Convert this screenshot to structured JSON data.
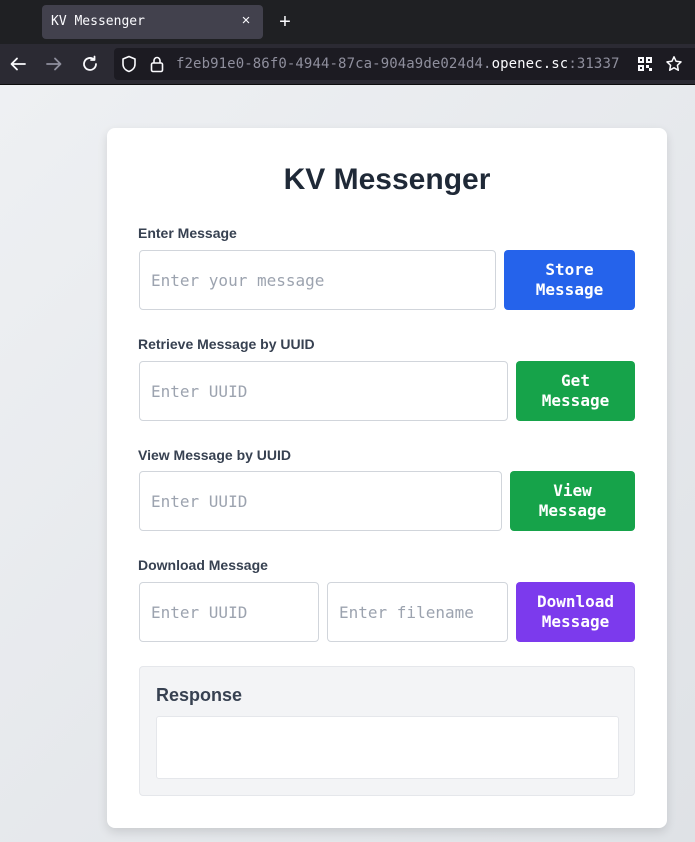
{
  "browser": {
    "tab_title": "KV Messenger",
    "tab_close_glyph": "×",
    "new_tab_glyph": "+",
    "url": {
      "prefix": "f2eb91e0-86f0-4944-87ca-904a9de024d4.",
      "host": "openec.sc",
      "port": ":31337"
    },
    "icons": [
      "back-arrow-icon",
      "forward-arrow-icon",
      "reload-icon",
      "tracking-shield-icon",
      "lock-icon",
      "qr-code-icon",
      "bookmark-star-icon"
    ]
  },
  "page": {
    "title": "KV Messenger",
    "store": {
      "label": "Enter Message",
      "placeholder": "Enter your message",
      "value": "",
      "button": "Store Message"
    },
    "retrieve": {
      "label": "Retrieve Message by UUID",
      "placeholder": "Enter UUID",
      "value": "",
      "button": "Get Message"
    },
    "view": {
      "label": "View Message by UUID",
      "placeholder": "Enter UUID",
      "value": "",
      "button": "View Message"
    },
    "download": {
      "label": "Download Message",
      "uuid_placeholder": "Enter UUID",
      "filename_placeholder": "Enter filename",
      "button": "Download Message"
    },
    "response": {
      "title": "Response",
      "content": ""
    }
  },
  "colors": {
    "store_button": "#2563eb",
    "get_button": "#16a34a",
    "view_button": "#16a34a",
    "download_button": "#7c3aed"
  }
}
